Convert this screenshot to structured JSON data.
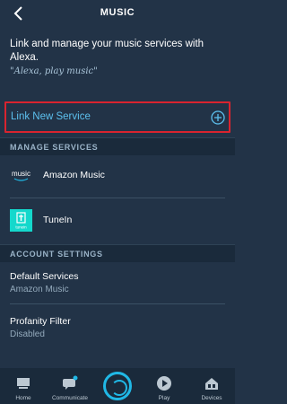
{
  "header": {
    "title": "MUSIC",
    "back_icon": "chevron-left-icon"
  },
  "intro": {
    "text": "Link and manage your music services with Alexa.",
    "example": "\"Alexa, play music\""
  },
  "link_new_service": {
    "label": "Link New Service",
    "icon": "add-circle-icon"
  },
  "manage_services": {
    "header": "MANAGE SERVICES",
    "items": [
      {
        "name": "Amazon Music",
        "logo_text": "music",
        "logo_bg": "#232f3e"
      },
      {
        "name": "TuneIn",
        "logo_text": "tunein",
        "logo_bg": "#14d8cc"
      }
    ]
  },
  "account_settings": {
    "header": "ACCOUNT SETTINGS",
    "items": [
      {
        "title": "Default Services",
        "value": "Amazon Music"
      },
      {
        "title": "Profanity Filter",
        "value": "Disabled"
      }
    ]
  },
  "bottom_nav": {
    "items": [
      {
        "label": "Home",
        "icon": "home-icon"
      },
      {
        "label": "Communicate",
        "icon": "chat-icon"
      },
      {
        "label": "",
        "icon": "alexa-icon"
      },
      {
        "label": "Play",
        "icon": "play-icon"
      },
      {
        "label": "Devices",
        "icon": "devices-icon"
      }
    ]
  },
  "colors": {
    "background": "#223347",
    "accent": "#5cc0ee",
    "highlight_border": "#d9242f",
    "section_bg": "#1a2a3b",
    "alexa_blue": "#20b8e6"
  }
}
